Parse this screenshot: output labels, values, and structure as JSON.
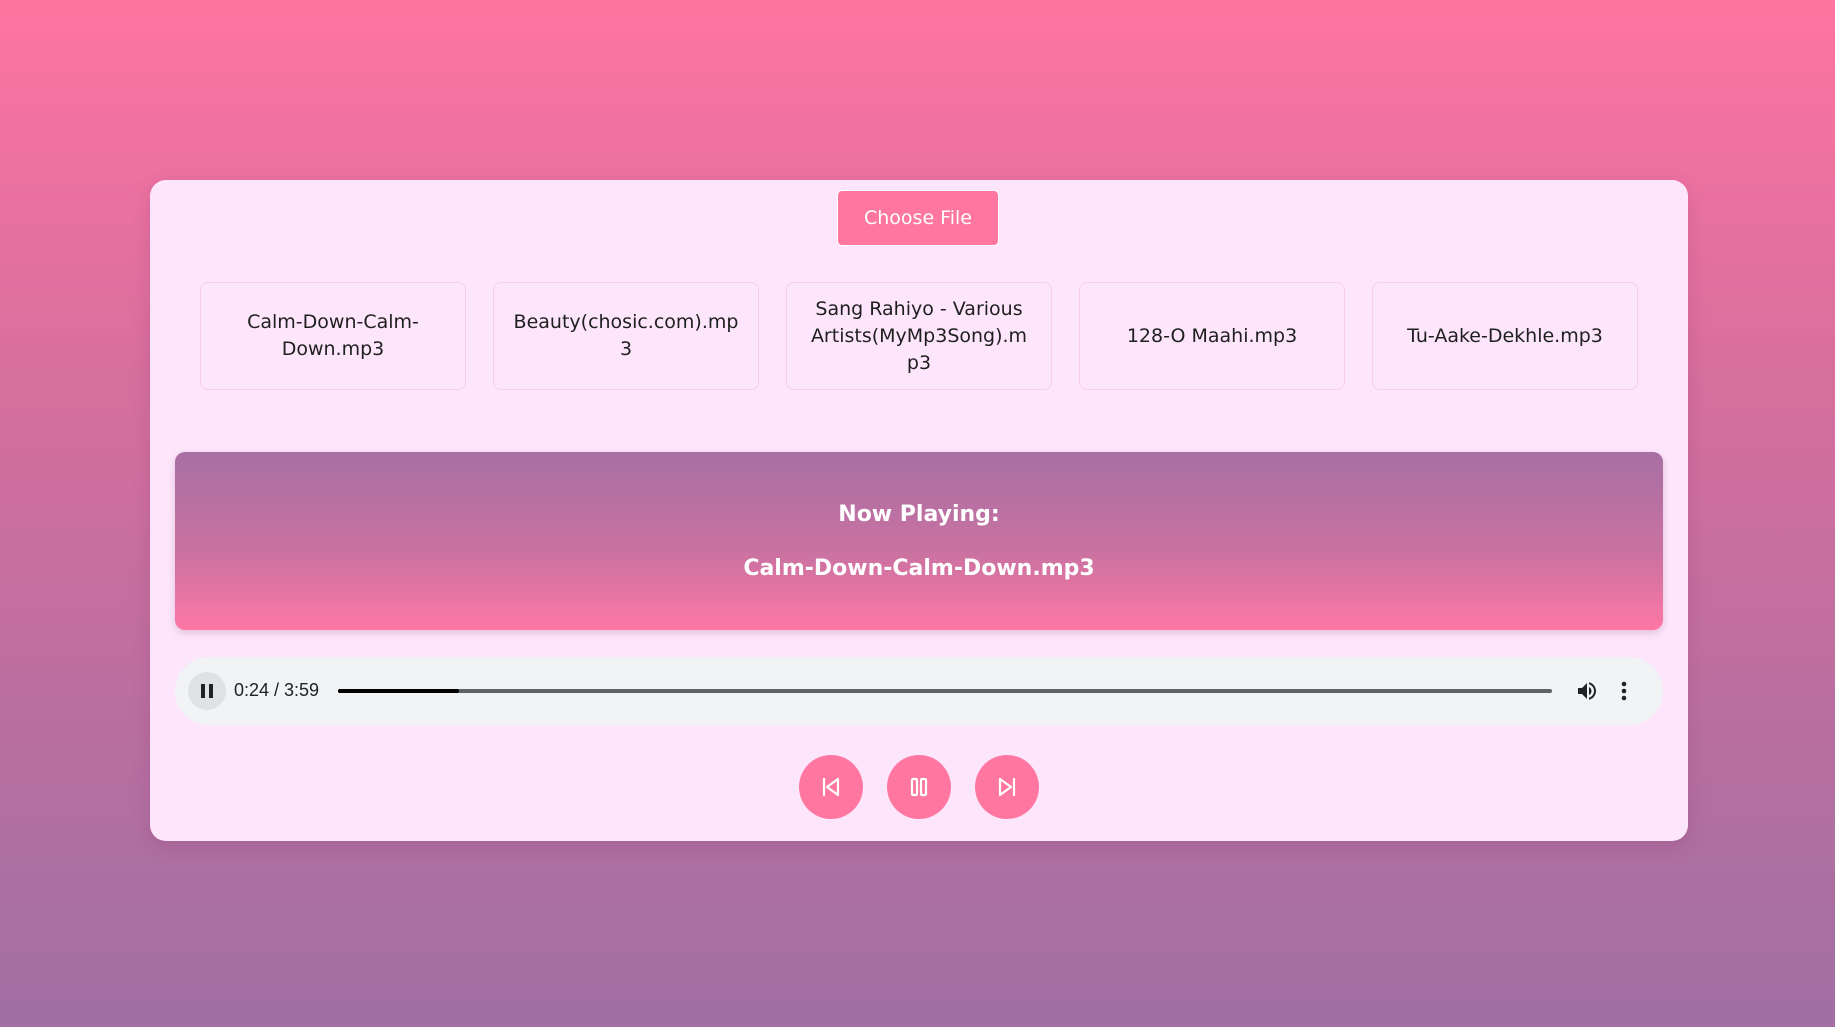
{
  "upload": {
    "choose_label": "Choose File"
  },
  "playlist": {
    "items": [
      {
        "name": "Calm-Down-Calm-Down.mp3"
      },
      {
        "name": "Beauty(chosic.com).mp3"
      },
      {
        "name": "Sang Rahiyo - Various Artists(MyMp3Song).mp3"
      },
      {
        "name": "128-O Maahi.mp3"
      },
      {
        "name": "Tu-Aake-Dekhle.mp3"
      }
    ]
  },
  "now_playing": {
    "label": "Now Playing:",
    "title": "Calm-Down-Calm-Down.mp3"
  },
  "audio_player": {
    "time": "0:24 / 3:59",
    "progress": 0.1,
    "state": "playing",
    "play_pause_icon": "pause-icon",
    "volume_icon": "volume-icon",
    "more_icon": "more-vert-icon"
  },
  "controls": {
    "previous_icon": "skip-previous-icon",
    "play_pause_icon": "pause-icon",
    "next_icon": "skip-next-icon"
  },
  "colors": {
    "accent": "#ff76a1",
    "card_background": "#fde6fb",
    "background_top": "#ff74a1",
    "background_bottom": "#a16fa3"
  }
}
